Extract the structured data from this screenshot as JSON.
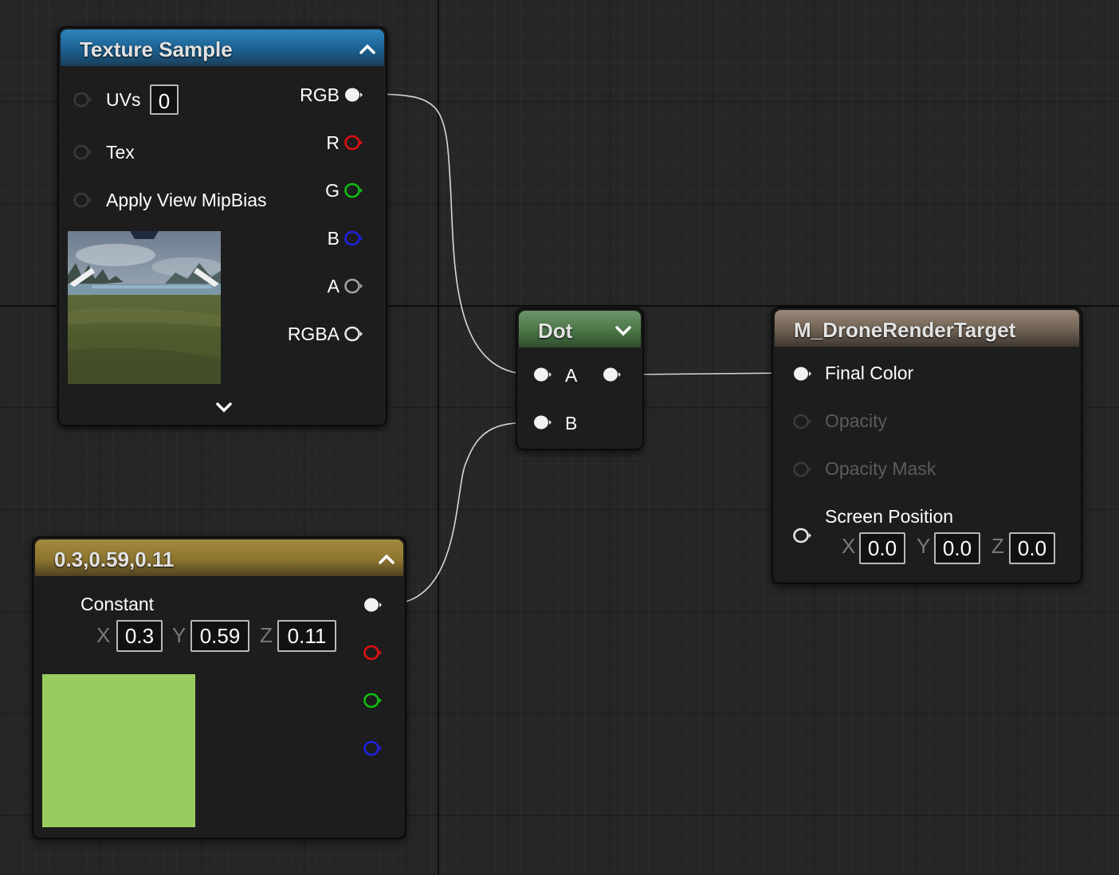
{
  "graph": {
    "texture_node": {
      "title": "Texture Sample",
      "inputs": [
        "UVs",
        "Tex",
        "Apply View MipBias"
      ],
      "uv_index": "0",
      "outputs": [
        "RGB",
        "R",
        "G",
        "B",
        "A",
        "RGBA"
      ]
    },
    "dot_node": {
      "title": "Dot",
      "inputs": [
        "A",
        "B"
      ]
    },
    "material_node": {
      "title": "M_DroneRenderTarget",
      "inputs": [
        "Final Color",
        "Opacity",
        "Opacity Mask",
        "Screen Position"
      ],
      "screen_position": {
        "x_label": "X",
        "x": "0.0",
        "y_label": "Y",
        "y": "0.0",
        "z_label": "Z",
        "z": "0.0"
      }
    },
    "constant_node": {
      "title": "0.3,0.59,0.11",
      "label": "Constant",
      "x_label": "X",
      "x": "0.3",
      "y_label": "Y",
      "y": "0.59",
      "z_label": "Z",
      "z": "0.11",
      "swatch_color": "#99cc5e"
    }
  },
  "colors": {
    "canvas_bg": "#262626",
    "texture_header": "#1f6aa0",
    "dot_header": "#4f7a4a",
    "material_header": "#6e6052",
    "constant_header": "#8c7530",
    "pin_red": "#e01010",
    "pin_green": "#10c010",
    "pin_blue": "#2020e0"
  },
  "icons": [
    "chevron-up-icon",
    "chevron-down-icon",
    "pin-icon"
  ]
}
